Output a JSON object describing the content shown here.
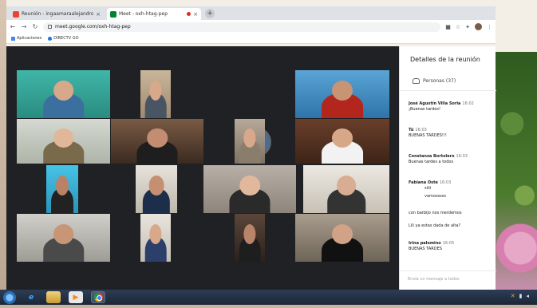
{
  "browser": {
    "tabs": [
      {
        "title": "Reunión - ingaamaraalejandro",
        "favicon_color": "#ea4335",
        "active": false
      },
      {
        "title": "Meet - oxh-htag-pep",
        "favicon_color": "#00832d",
        "active": true
      }
    ],
    "tab_close": "×",
    "new_tab": "+",
    "url": "meet.google.com/oxh-htag-pep",
    "bookmarks": [
      {
        "label": "Aplicaciones"
      },
      {
        "label": "DIRECTV GO"
      }
    ]
  },
  "side_panel": {
    "title": "Detalles de la reunión",
    "people_label": "Personas (37)",
    "compose_placeholder": "Envía un mensaje a todos",
    "messages": [
      {
        "sender": "José Agustín Villa Soria",
        "time": "16:02",
        "text": "¡Buenas tardes!"
      },
      {
        "sender": "Tú",
        "time": "16:03",
        "text": "BUENAS TARDES!!!"
      },
      {
        "sender": "Constanza Bortolero",
        "time": "16:03",
        "text": "Buenas tardes a todos"
      },
      {
        "sender": "Fabiana Oste",
        "time": "16:03",
        "text": "siiii"
      },
      {
        "sender": "",
        "time": "",
        "text": "vamosssss"
      },
      {
        "sender": "",
        "time": "",
        "text": "con barbijo nos merdemos"
      },
      {
        "sender": "",
        "time": "",
        "text": "Lili ya estas dada de alta?"
      },
      {
        "sender": "Irina palomino",
        "time": "16:05",
        "text": "BUENAS TARDES"
      }
    ]
  },
  "taskbar": {
    "ie_glyph": "e",
    "media_glyph": "▶",
    "tray_warning": "✕"
  },
  "colors": {
    "meet_background": "#202124",
    "taskbar": "#1c2738"
  }
}
